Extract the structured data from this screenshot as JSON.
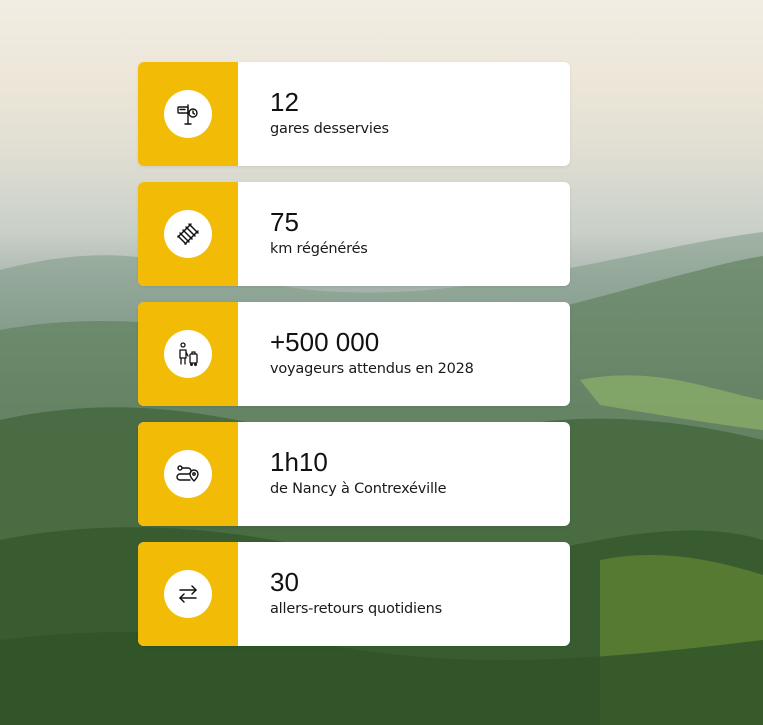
{
  "theme": {
    "accent": "#f2bb05",
    "card_background": "#ffffff"
  },
  "stats": [
    {
      "icon": "station-signpost-icon",
      "value": "12",
      "label": "gares desservies"
    },
    {
      "icon": "railway-track-icon",
      "value": "75",
      "label": "km régénérés"
    },
    {
      "icon": "travelers-luggage-icon",
      "value": "+500 000",
      "label": "voyageurs attendus en 2028"
    },
    {
      "icon": "route-pin-icon",
      "value": "1h10",
      "label": "de Nancy à Contrexéville"
    },
    {
      "icon": "round-trip-arrows-icon",
      "value": "30",
      "label": "allers-retours quotidiens"
    }
  ]
}
